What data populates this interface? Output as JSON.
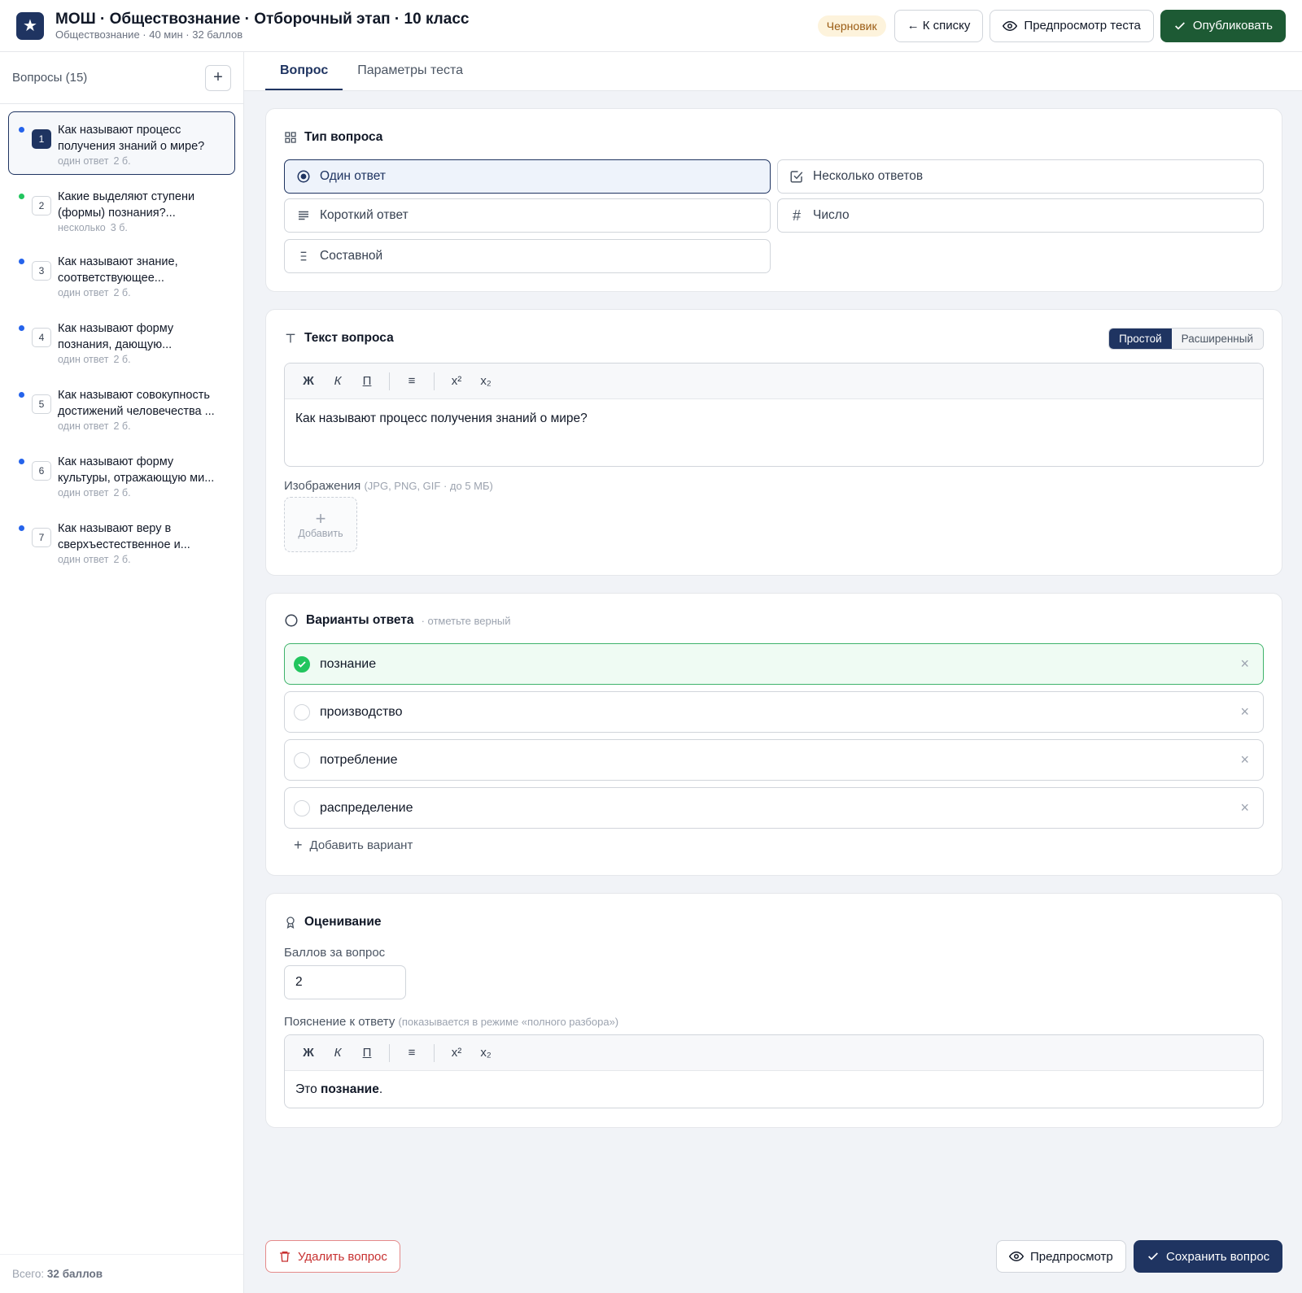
{
  "header": {
    "title": "МОШ · Обществознание · Отборочный этап · 10 класс",
    "subtitle": "Обществознание · 40 мин · 32 баллов",
    "status_badge": "Черновик",
    "back_button": "← К списку",
    "preview_test_button": "Предпросмотр теста",
    "publish_button": "Опубликовать",
    "logo_icon": "star-icon"
  },
  "sidebar": {
    "title": "Вопросы (15)",
    "add_icon": "plus-icon",
    "items": [
      {
        "num": "1",
        "text": "Как называют процесс получения знаний о мире?",
        "type": "один ответ",
        "points": "2 б.",
        "status_color": "#2563eb",
        "active": true
      },
      {
        "num": "2",
        "text": "Какие выделяют ступени (формы) познания?...",
        "type": "несколько",
        "points": "3 б.",
        "status_color": "#22c55e",
        "active": false
      },
      {
        "num": "3",
        "text": "Как называют знание, соответствующее...",
        "type": "один ответ",
        "points": "2 б.",
        "status_color": "#2563eb",
        "active": false
      },
      {
        "num": "4",
        "text": "Как называют форму познания, дающую...",
        "type": "один ответ",
        "points": "2 б.",
        "status_color": "#2563eb",
        "active": false
      },
      {
        "num": "5",
        "text": "Как называют совокупность достижений человечества ...",
        "type": "один ответ",
        "points": "2 б.",
        "status_color": "#2563eb",
        "active": false
      },
      {
        "num": "6",
        "text": "Как называют форму культуры, отражающую ми...",
        "type": "один ответ",
        "points": "2 б.",
        "status_color": "#2563eb",
        "active": false
      },
      {
        "num": "7",
        "text": "Как называют веру в сверхъестественное и...",
        "type": "один ответ",
        "points": "2 б.",
        "status_color": "#2563eb",
        "active": false
      }
    ],
    "footer_prefix": "Всего:",
    "footer_total": "32 баллов"
  },
  "tabs": [
    {
      "label": "Вопрос",
      "active": true
    },
    {
      "label": "Параметры теста",
      "active": false
    }
  ],
  "question_type": {
    "title": "Тип вопроса",
    "options": [
      {
        "label": "Один ответ",
        "icon": "radio-target-icon",
        "active": true
      },
      {
        "label": "Несколько ответов",
        "icon": "checkbox-icon",
        "active": false
      },
      {
        "label": "Короткий ответ",
        "icon": "text-lines-icon",
        "active": false
      },
      {
        "label": "Число",
        "icon": "hash-icon",
        "active": false
      },
      {
        "label": "Составной",
        "icon": "list-icon",
        "active": false
      }
    ]
  },
  "question_text": {
    "title": "Текст вопроса",
    "mode_simple": "Простой",
    "mode_extended": "Расширенный",
    "toolbar": {
      "bold": "Ж",
      "italic": "К",
      "underline": "П",
      "list": "≡",
      "sup": "x²",
      "sub": "x₂"
    },
    "content": "Как называют процесс получения знаний о мире?",
    "images_label": "Изображения",
    "images_hint": "(JPG, PNG, GIF · до 5 МБ)",
    "add_image": "Добавить"
  },
  "answers": {
    "title": "Варианты ответа",
    "hint": "· отметьте верный",
    "options": [
      {
        "text": "познание",
        "correct": true
      },
      {
        "text": "производство",
        "correct": false
      },
      {
        "text": "потребление",
        "correct": false
      },
      {
        "text": "распределение",
        "correct": false
      }
    ],
    "add_option": "Добавить вариант"
  },
  "grading": {
    "title": "Оценивание",
    "points_label": "Баллов за вопрос",
    "points_value": "2",
    "explanation_label": "Пояснение к ответу",
    "explanation_hint": "(показывается в режиме «полного разбора»)",
    "explanation_prefix": "Это ",
    "explanation_bold": "познание",
    "explanation_suffix": "."
  },
  "footer": {
    "delete_button": "Удалить вопрос",
    "preview_button": "Предпросмотр",
    "save_button": "Сохранить вопрос"
  },
  "colors": {
    "brand_navy": "#1f3461",
    "publish_green": "#1d5a34",
    "correct_green": "#22c55e",
    "danger": "#c73030"
  }
}
